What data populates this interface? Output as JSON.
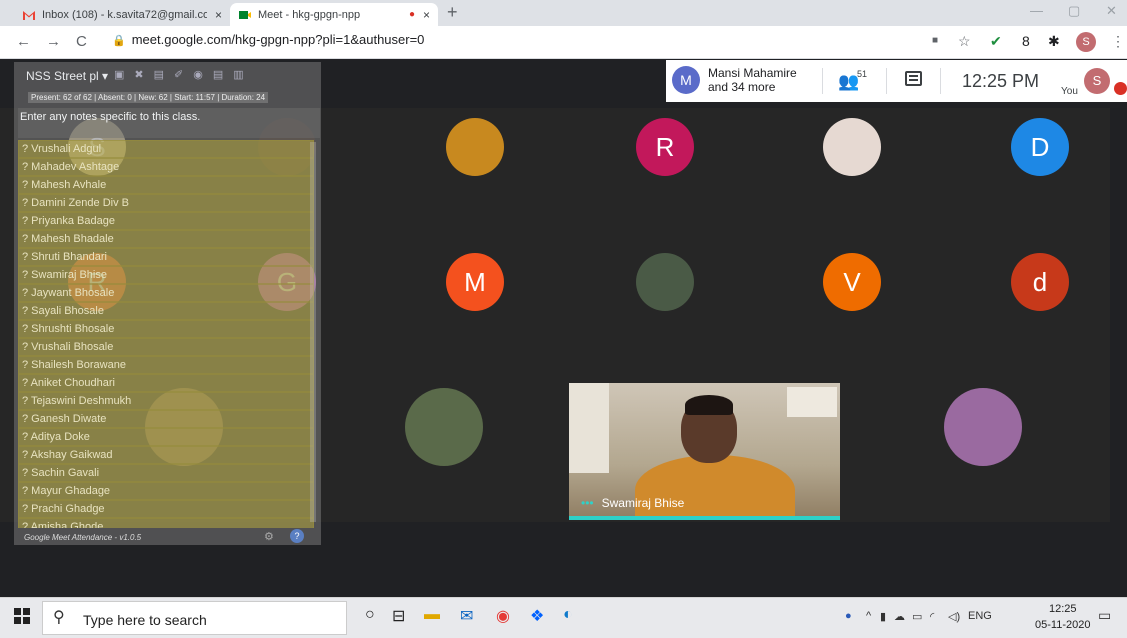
{
  "browser": {
    "tabs": [
      {
        "title": "Inbox (108) - k.savita72@gmail.co",
        "close": "×"
      },
      {
        "title": "Meet - hkg-gpgn-npp",
        "close": "×"
      }
    ],
    "new_tab": "+",
    "window_controls": [
      "—",
      "▢",
      "✕"
    ],
    "url": "meet.google.com/hkg-gpgn-npp?pli=1&authuser=0",
    "profile_initial": "S"
  },
  "meet": {
    "presenter_initial": "M",
    "presenter_name": "Mansi Mahamire",
    "presenter_more": "and 34 more",
    "participant_count": "51",
    "clock": "12:25 PM",
    "you_label": "You",
    "you_initial": "S",
    "tiles": [
      {
        "letter": "S",
        "color": "#c7b98d"
      },
      {
        "letter": "",
        "color": "#3a2a20"
      },
      {
        "letter": "",
        "color": "#c8891f"
      },
      {
        "letter": "R",
        "color": "#c2185b"
      },
      {
        "letter": "",
        "color": "#e6d9d2"
      },
      {
        "letter": "D",
        "color": "#1e88e5"
      },
      {
        "letter": "R",
        "color": "#f4511e"
      },
      {
        "letter": "G",
        "color": "#c04cbd"
      },
      {
        "letter": "M",
        "color": "#f4511e"
      },
      {
        "letter": "",
        "color": "#4a5a46"
      },
      {
        "letter": "V",
        "color": "#ef6c00"
      },
      {
        "letter": "d",
        "color": "#c7391a"
      },
      {
        "letter": "",
        "color": "#8a6a4a"
      },
      {
        "letter": "",
        "color": "#5a6a4a"
      },
      {
        "letter": "",
        "color": "#9a6aa0"
      }
    ],
    "video_name": "Swamiraj Bhise",
    "video_dots": "•••"
  },
  "extension": {
    "title": "NSS Street pl ▾",
    "stats": "Present: 62 of 62 | Absent: 0 | New: 62 | Start: 11:57 | Duration: 24",
    "notes_placeholder": "Enter any notes specific to this class.",
    "footer": "Google Meet Attendance - v1.0.5",
    "students": [
      "? Vrushali Adgul",
      "? Mahadev Ashtage",
      "? Mahesh Avhale",
      "? Damini Zende Div B",
      "? Priyanka Badage",
      "? Mahesh Bhadale",
      "? Shruti Bhandari",
      "? Swamiraj Bhise",
      "? Jaywant Bhosale",
      "? Sayali Bhosale",
      "? Shrushti Bhosale",
      "? Vrushali Bhosale",
      "? Shailesh Borawane",
      "? Aniket Choudhari",
      "? Tejaswini Deshmukh",
      "? Ganesh Diwate",
      "? Aditya Doke",
      "? Akshay Gaikwad",
      "? Sachin Gavali",
      "? Mayur Ghadage",
      "? Prachi Ghadge",
      "? Amisha Ghode"
    ]
  },
  "taskbar": {
    "search_placeholder": "Type here to search",
    "language": "ENG",
    "time": "12:25",
    "date": "05-11-2020"
  }
}
